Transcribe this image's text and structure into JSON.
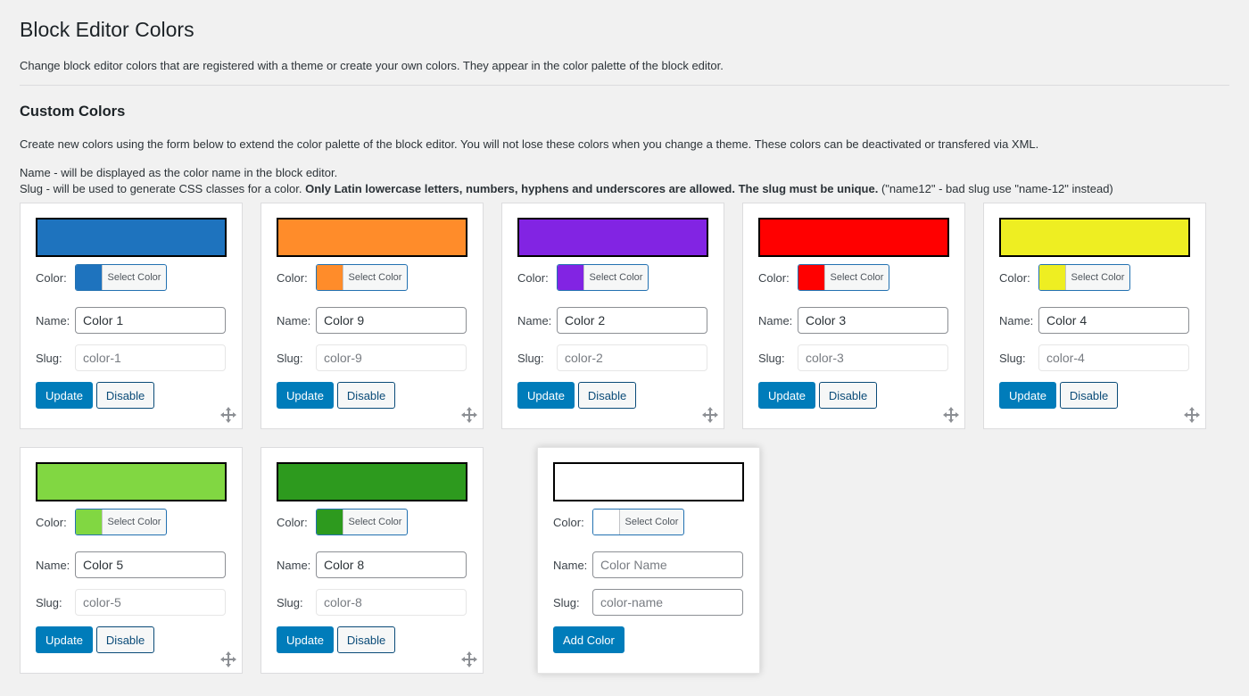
{
  "page": {
    "title": "Block Editor Colors",
    "intro": "Change block editor colors that are registered with a theme or create your own colors. They appear in the color palette of the block editor."
  },
  "section": {
    "title": "Custom Colors",
    "description": "Create new colors using the form below to extend the color palette of the block editor. You will not lose these colors when you change a theme. These colors can be deactivated or transfered via XML.",
    "help_name": "Name - will be displayed as the color name in the block editor.",
    "help_slug_prefix": "Slug - will be used to generate CSS classes for a color. ",
    "help_slug_bold": "Only Latin lowercase letters, numbers, hyphens and underscores are allowed. The slug must be unique.",
    "help_slug_suffix": " (\"name12\" - bad slug use \"name-12\" instead)"
  },
  "labels": {
    "color": "Color:",
    "name": "Name:",
    "slug": "Slug:",
    "select_color": "Select Color",
    "update": "Update",
    "disable": "Disable",
    "add_color": "Add Color"
  },
  "colors": [
    {
      "name": "Color 1",
      "slug": "color-1",
      "hex": "#1e73be"
    },
    {
      "name": "Color 9",
      "slug": "color-9",
      "hex": "#ff8c2a"
    },
    {
      "name": "Color 2",
      "slug": "color-2",
      "hex": "#8224e3"
    },
    {
      "name": "Color 3",
      "slug": "color-3",
      "hex": "#ff0000"
    },
    {
      "name": "Color 4",
      "slug": "color-4",
      "hex": "#eeee22"
    },
    {
      "name": "Color 5",
      "slug": "color-5",
      "hex": "#81d742"
    },
    {
      "name": "Color 8",
      "slug": "color-8",
      "hex": "#2d9a1e"
    }
  ],
  "new_color": {
    "hex": "#ffffff",
    "name_value": "",
    "name_placeholder": "Color Name",
    "slug_value": "",
    "slug_placeholder": "color-name"
  }
}
